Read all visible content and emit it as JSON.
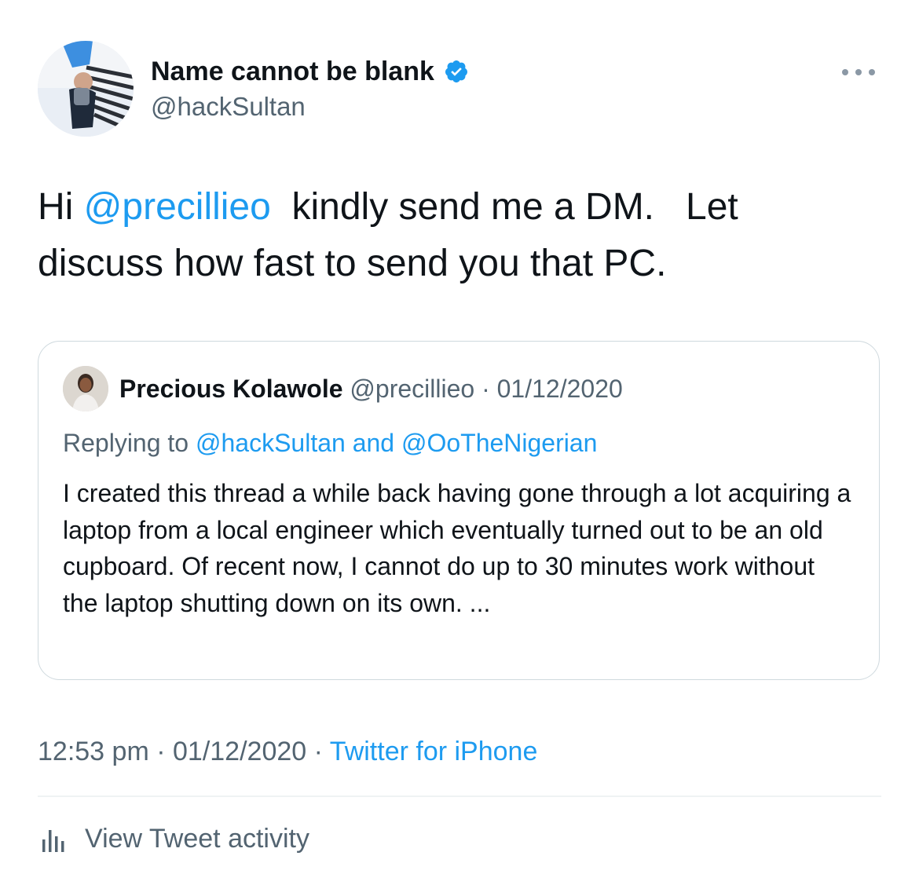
{
  "author": {
    "display_name": "Name cannot be blank",
    "handle": "@hackSultan",
    "verified": true
  },
  "tweet": {
    "text_prefix": "Hi ",
    "mention": "@precillieo",
    "text_line1_rest": "  kindly send me a DM.   Let",
    "text_line2": "discuss how fast to send you that PC."
  },
  "quote": {
    "name": "Precious Kolawole",
    "handle": "@precillieo",
    "separator": "·",
    "date": "01/12/2020",
    "replying_prefix": "Replying to ",
    "replying_user1": "@hackSultan",
    "replying_and": " and ",
    "replying_user2": "@OoTheNigerian",
    "text": "I created this thread a while back having gone through a lot acquiring a laptop from a local engineer which eventually turned out to be an old cupboard. Of recent now, I cannot do up to 30 minutes work without the laptop shutting down on its own. ..."
  },
  "meta": {
    "time": "12:53 pm",
    "separator": "·",
    "date": "01/12/2020",
    "source": "Twitter for iPhone"
  },
  "activity": {
    "label": "View Tweet activity"
  },
  "colors": {
    "accent": "#1d9bf0",
    "secondary_text": "#536471",
    "primary_text": "#0f1419",
    "border": "#cfd9de"
  },
  "icons": {
    "verified": "verified-badge-icon",
    "more": "more-options-icon",
    "activity": "bar-chart-icon"
  }
}
